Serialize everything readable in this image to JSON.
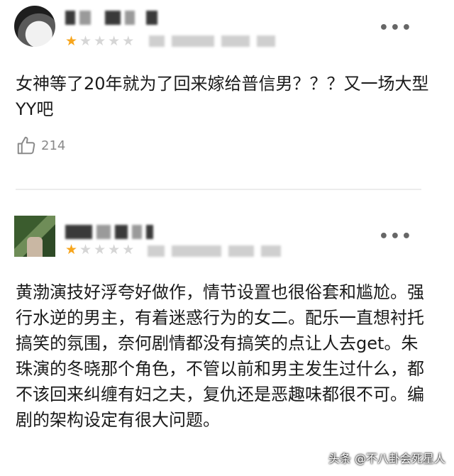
{
  "reviews": [
    {
      "rating": 1,
      "max_rating": 5,
      "more_label": "•••",
      "text": "女神等了20年就为了回来嫁给普信男？？？又一场大型YY吧",
      "likes": "214"
    },
    {
      "rating": 1,
      "max_rating": 5,
      "more_label": "•••",
      "text": "黄渤演技好浮夸好做作，情节设置也很俗套和尴尬。强行水逆的男主，有着迷惑行为的女二。配乐一直想衬托搞笑的氛围，奈何剧情都没有搞笑的点让人去get。朱珠演的冬晓那个角色，不管以前和男主发生过什么，都不该回来纠缠有妇之夫，复仇还是恶趣味都很不可。编剧的架构设定有很大问题。"
    }
  ],
  "watermark": "头条 @不八卦会死星人",
  "icons": {
    "like": "thumbs-up-icon",
    "more": "more-dots-icon",
    "star": "star-icon"
  },
  "colors": {
    "star_on": "#f7a51c",
    "star_off": "#d6d6d6",
    "text": "#1a1a1a",
    "muted": "#8a8a8a"
  }
}
